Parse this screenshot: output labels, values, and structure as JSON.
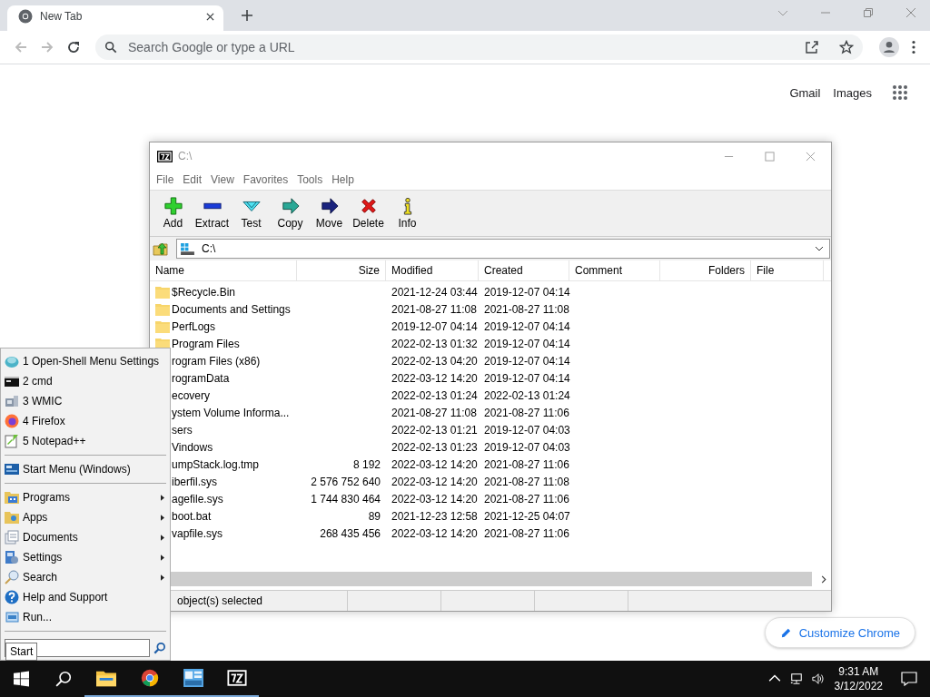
{
  "browser": {
    "tab": {
      "title": "New Tab"
    },
    "omnibox": {
      "placeholder": "Search Google or type a URL"
    },
    "links": [
      "Gmail",
      "Images"
    ],
    "customize_button": "Customize Chrome"
  },
  "archiver": {
    "window_title": "C:\\",
    "menu": [
      "File",
      "Edit",
      "View",
      "Favorites",
      "Tools",
      "Help"
    ],
    "toolbar": [
      {
        "label": "Add",
        "kind": "add"
      },
      {
        "label": "Extract",
        "kind": "extract"
      },
      {
        "label": "Test",
        "kind": "test"
      },
      {
        "label": "Copy",
        "kind": "copy"
      },
      {
        "label": "Move",
        "kind": "move"
      },
      {
        "label": "Delete",
        "kind": "delete"
      },
      {
        "label": "Info",
        "kind": "info"
      }
    ],
    "path": "C:\\",
    "columns": [
      "Name",
      "Size",
      "Modified",
      "Created",
      "Comment",
      "Folders",
      "File"
    ],
    "rows": [
      {
        "name": "$Recycle.Bin",
        "kind": "folder",
        "modified": "2021-12-24 03:44",
        "created": "2019-12-07 04:14"
      },
      {
        "name": "Documents and Settings",
        "kind": "folder",
        "modified": "2021-08-27 11:08",
        "created": "2021-08-27 11:08"
      },
      {
        "name": "PerfLogs",
        "kind": "folder",
        "modified": "2019-12-07 04:14",
        "created": "2019-12-07 04:14"
      },
      {
        "name": "Program Files",
        "kind": "folder",
        "modified": "2022-02-13 01:32",
        "created": "2019-12-07 04:14"
      },
      {
        "name": "rogram Files (x86)",
        "kind": "hidden",
        "modified": "2022-02-13 04:20",
        "created": "2019-12-07 04:14"
      },
      {
        "name": "rogramData",
        "kind": "hidden",
        "modified": "2022-03-12 14:20",
        "created": "2019-12-07 04:14"
      },
      {
        "name": "ecovery",
        "kind": "hidden",
        "modified": "2022-02-13 01:24",
        "created": "2022-02-13 01:24"
      },
      {
        "name": "ystem Volume Informa...",
        "kind": "hidden",
        "modified": "2021-08-27 11:08",
        "created": "2021-08-27 11:06"
      },
      {
        "name": "sers",
        "kind": "hidden",
        "modified": "2022-02-13 01:21",
        "created": "2019-12-07 04:03"
      },
      {
        "name": "Vindows",
        "kind": "hidden",
        "modified": "2022-02-13 01:23",
        "created": "2019-12-07 04:03"
      },
      {
        "name": "umpStack.log.tmp",
        "kind": "hidden",
        "size": "8 192",
        "modified": "2022-03-12 14:20",
        "created": "2021-08-27 11:06"
      },
      {
        "name": "iberfil.sys",
        "kind": "hidden",
        "size": "2 576 752 640",
        "modified": "2022-03-12 14:20",
        "created": "2021-08-27 11:08"
      },
      {
        "name": "agefile.sys",
        "kind": "hidden",
        "size": "1 744 830 464",
        "modified": "2022-03-12 14:20",
        "created": "2021-08-27 11:06"
      },
      {
        "name": "boot.bat",
        "kind": "hidden",
        "size": "89",
        "modified": "2021-12-23 12:58",
        "created": "2021-12-25 04:07"
      },
      {
        "name": "vapfile.sys",
        "kind": "hidden",
        "size": "268 435 456",
        "modified": "2022-03-12 14:20",
        "created": "2021-08-27 11:06"
      }
    ],
    "status": "object(s) selected"
  },
  "start_menu": {
    "sections": [
      [
        {
          "label": "1 Open-Shell Menu Settings",
          "kind": "shell",
          "submenu": false
        },
        {
          "label": "2 cmd",
          "kind": "cmd",
          "submenu": false
        },
        {
          "label": "3 WMIC",
          "kind": "wmic",
          "submenu": false
        },
        {
          "label": "4 Firefox",
          "kind": "firefox",
          "submenu": false
        },
        {
          "label": "5 Notepad++",
          "kind": "notepad",
          "submenu": false
        }
      ],
      [
        {
          "label": "Start Menu (Windows)",
          "kind": "startmenu",
          "submenu": false
        }
      ],
      [
        {
          "label": "Programs",
          "kind": "programs",
          "submenu": true
        },
        {
          "label": "Apps",
          "kind": "apps",
          "submenu": true
        },
        {
          "label": "Documents",
          "kind": "documents",
          "submenu": true
        },
        {
          "label": "Settings",
          "kind": "settings",
          "submenu": true
        },
        {
          "label": "Search",
          "kind": "search",
          "submenu": true
        },
        {
          "label": "Help and Support",
          "kind": "help",
          "submenu": false
        },
        {
          "label": "Run...",
          "kind": "run",
          "submenu": false
        }
      ]
    ],
    "tooltip": "Start"
  },
  "taskbar": {
    "apps": [
      {
        "kind": "explorer",
        "running": true
      },
      {
        "kind": "chrome",
        "running": true
      },
      {
        "kind": "app",
        "running": true
      },
      {
        "kind": "archiver",
        "running": true
      }
    ],
    "clock": {
      "time": "9:31 AM",
      "date": "3/12/2022"
    }
  }
}
